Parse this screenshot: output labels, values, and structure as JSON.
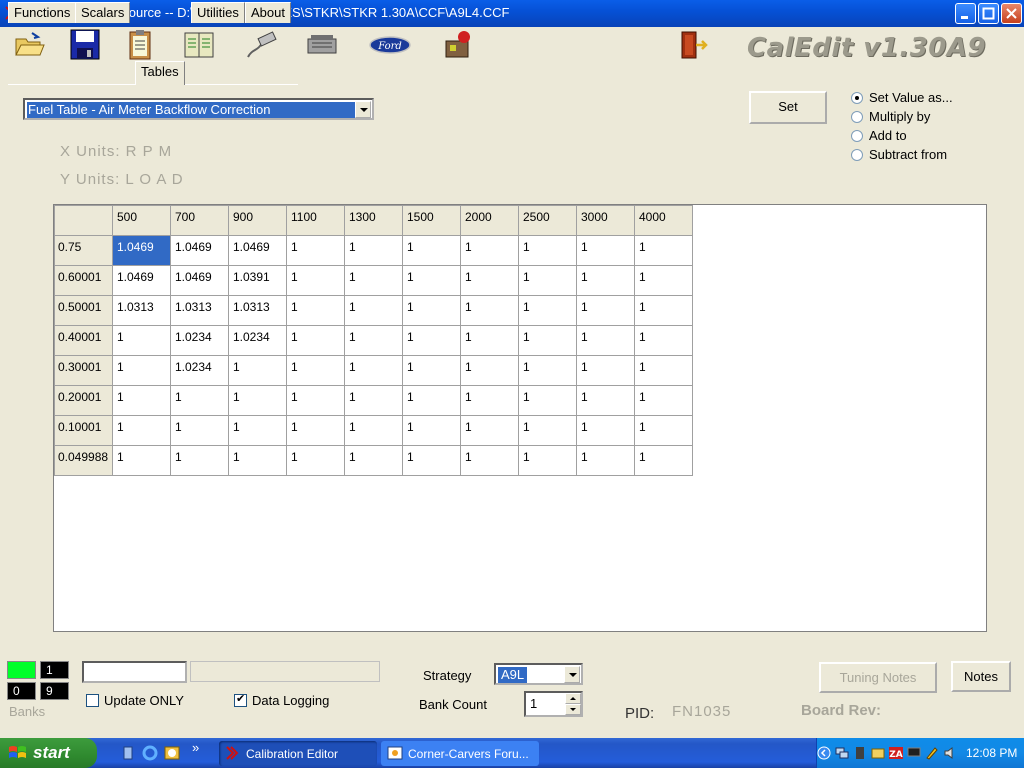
{
  "window": {
    "title": "EEC Calibration Source -- D:\\PROGRAM FILES\\STKR\\STKR 1.30A\\CCF\\A9L4.CCF"
  },
  "brand": "CalEdit v1.30A9",
  "tabs": [
    {
      "label": "Functions"
    },
    {
      "label": "Scalars"
    },
    {
      "label": "Tables"
    },
    {
      "label": "Utilities"
    },
    {
      "label": "About"
    }
  ],
  "table_select": {
    "value": "Fuel Table - Air Meter Backflow Correction"
  },
  "set_button": "Set",
  "radio_options": [
    {
      "label": "Set Value as...",
      "selected": true
    },
    {
      "label": "Multiply by",
      "selected": false
    },
    {
      "label": "Add to",
      "selected": false
    },
    {
      "label": "Subtract from",
      "selected": false
    }
  ],
  "x_units": "X Units: R P M",
  "y_units": "Y Units: L O A D",
  "grid": {
    "columns": [
      "500",
      "700",
      "900",
      "1100",
      "1300",
      "1500",
      "2000",
      "2500",
      "3000",
      "4000"
    ],
    "rows": [
      {
        "label": "0.75",
        "values": [
          "1.0469",
          "1.0469",
          "1.0469",
          "1",
          "1",
          "1",
          "1",
          "1",
          "1",
          "1"
        ]
      },
      {
        "label": "0.60001",
        "values": [
          "1.0469",
          "1.0469",
          "1.0391",
          "1",
          "1",
          "1",
          "1",
          "1",
          "1",
          "1"
        ]
      },
      {
        "label": "0.50001",
        "values": [
          "1.0313",
          "1.0313",
          "1.0313",
          "1",
          "1",
          "1",
          "1",
          "1",
          "1",
          "1"
        ]
      },
      {
        "label": "0.40001",
        "values": [
          "1",
          "1.0234",
          "1.0234",
          "1",
          "1",
          "1",
          "1",
          "1",
          "1",
          "1"
        ]
      },
      {
        "label": "0.30001",
        "values": [
          "1",
          "1.0234",
          "1",
          "1",
          "1",
          "1",
          "1",
          "1",
          "1",
          "1"
        ]
      },
      {
        "label": "0.20001",
        "values": [
          "1",
          "1",
          "1",
          "1",
          "1",
          "1",
          "1",
          "1",
          "1",
          "1"
        ]
      },
      {
        "label": "0.10001",
        "values": [
          "1",
          "1",
          "1",
          "1",
          "1",
          "1",
          "1",
          "1",
          "1",
          "1"
        ]
      },
      {
        "label": "0.049988",
        "values": [
          "1",
          "1",
          "1",
          "1",
          "1",
          "1",
          "1",
          "1",
          "1",
          "1"
        ]
      }
    ]
  },
  "banks": {
    "cells": [
      "0",
      "1",
      "0",
      "9"
    ],
    "label": "Banks"
  },
  "update_only": {
    "label": "Update ONLY",
    "checked": false
  },
  "data_logging": {
    "label": "Data Logging",
    "checked": true
  },
  "strategy": {
    "label": "Strategy",
    "value": "A9L"
  },
  "bank_count": {
    "label": "Bank Count",
    "value": "1"
  },
  "tuning_notes_button": "Tuning Notes",
  "notes_button": "Notes",
  "pid": {
    "label": "PID:",
    "value": "FN1035"
  },
  "board_rev": "Board Rev:",
  "taskbar": {
    "start": "start",
    "tasks": [
      {
        "label": "Calibration Editor"
      },
      {
        "label": "Corner-Carvers Foru..."
      }
    ],
    "clock": "12:08 PM"
  },
  "colors": {
    "selection": "#316ac5",
    "titlebar": "#0651d6",
    "face": "#ece9d8"
  }
}
